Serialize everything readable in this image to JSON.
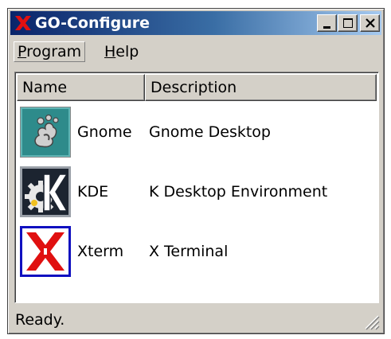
{
  "window": {
    "title": "GO-Configure",
    "title_icon": "x-logo-icon",
    "controls": [
      "minimize",
      "maximize",
      "close"
    ]
  },
  "menu": {
    "program_prefix": "",
    "program_underline": "P",
    "program_rest": "rogram",
    "help_underline": "H",
    "help_rest": "elp"
  },
  "list": {
    "columns": [
      "Name",
      "Description"
    ],
    "rows": [
      {
        "name": "Gnome",
        "description": "Gnome Desktop",
        "icon": "gnome-foot-icon"
      },
      {
        "name": "KDE",
        "description": "K Desktop Environment",
        "icon": "kde-gear-icon"
      },
      {
        "name": "Xterm",
        "description": "X Terminal",
        "icon": "x-terminal-icon"
      }
    ]
  },
  "status": {
    "text": "Ready."
  },
  "colors": {
    "titlebar_start": "#0a246a",
    "titlebar_end": "#a6caf0",
    "face": "#d4d0c8",
    "x_red": "#e01010"
  }
}
